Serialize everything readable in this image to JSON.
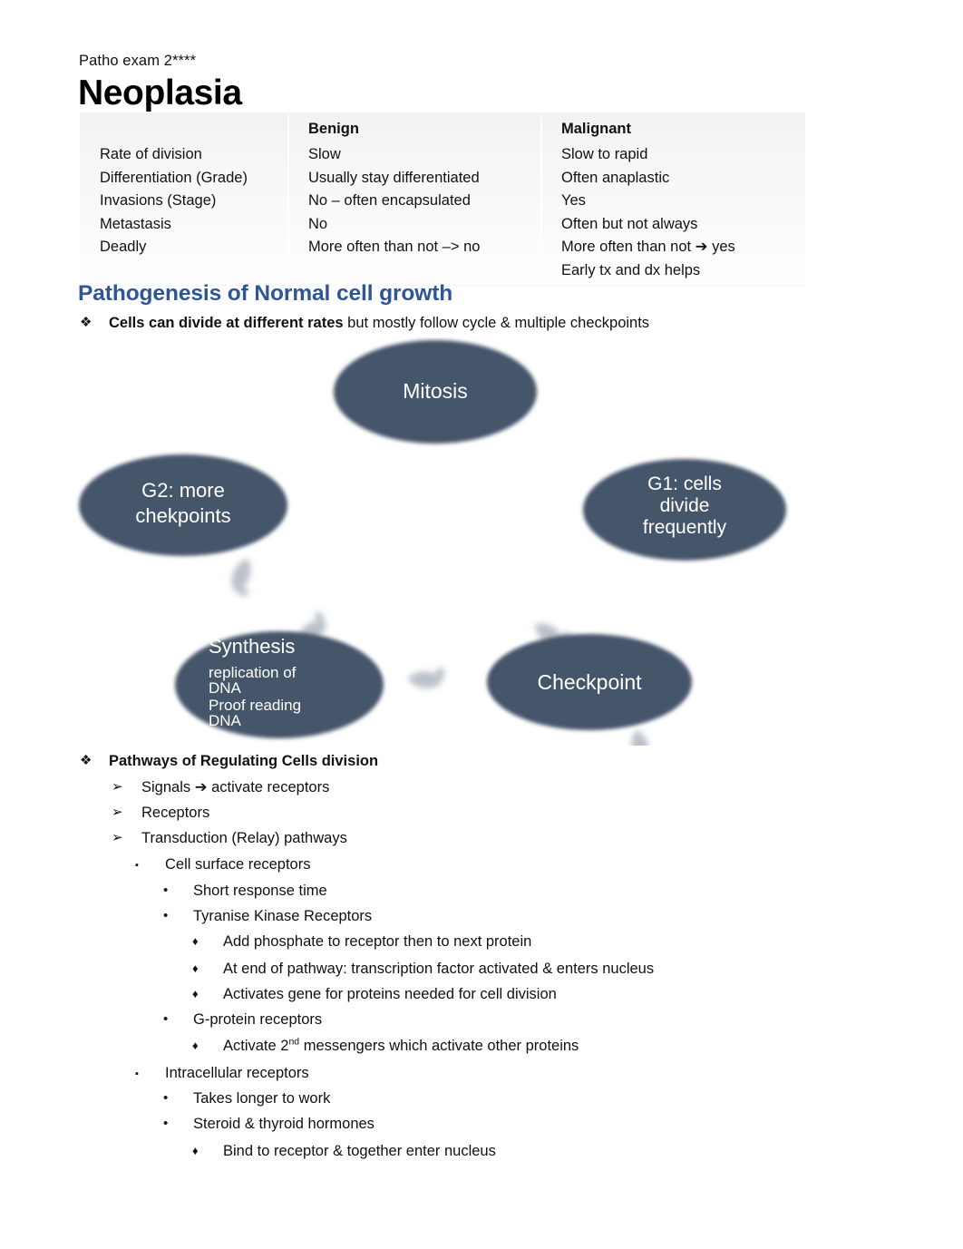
{
  "document": {
    "tagline": "Patho exam 2****",
    "title": "Neoplasia"
  },
  "comparison_table": {
    "headers": [
      "",
      "Benign",
      "Malignant"
    ],
    "rows": [
      {
        "label": "Rate of division",
        "benign": "Slow",
        "malignant": "Slow to rapid",
        "malignant_extra": ""
      },
      {
        "label": "Differentiation (Grade)",
        "benign": "Usually stay differentiated",
        "malignant": "Often anaplastic",
        "malignant_extra": ""
      },
      {
        "label": "Invasions (Stage)",
        "benign": "No – often encapsulated",
        "malignant": "Yes",
        "malignant_extra": ""
      },
      {
        "label": "Metastasis",
        "benign": "No",
        "malignant": "Often but not always",
        "malignant_extra": ""
      },
      {
        "label": "Deadly",
        "benign": "More often than not –> no",
        "malignant": "More often than not ➔ yes",
        "malignant_extra": "Early tx and dx helps"
      }
    ]
  },
  "section": {
    "heading": "Pathogenesis of Normal cell growth",
    "heading_color": "#2f5596"
  },
  "bullets": {
    "b1_bold": "Cells can divide at different rates",
    "b1_rest": " but mostly follow cycle & multiple checkpoints",
    "b2": "Pathways of Regulating Cells division",
    "b3": "Signals ➔ activate receptors",
    "b4": "Receptors",
    "b5": "Transduction (Relay) pathways",
    "b6": "Cell surface receptors",
    "b7": "Short response time",
    "b8": "Tyranise Kinase Receptors",
    "b9": "Add phosphate to receptor then to next protein",
    "b10": "At end of pathway: transcription factor activated & enters nucleus",
    "b11": "Activates gene for proteins needed for cell division",
    "b12": "G-protein receptors",
    "b13_pre": "Activate 2",
    "b13_sup": "nd",
    "b13_post": " messengers which activate other proteins",
    "b14": "Intracellular receptors",
    "b15": "Takes longer to work",
    "b16": "Steroid & thyroid hormones",
    "b17": "Bind to receptor & together enter nucleus"
  },
  "markers": {
    "level1": "❖",
    "level2": "➢",
    "level3": "▪",
    "level4": "•",
    "level5": "♦"
  },
  "cycle_diagram": {
    "fill_color": "#44546a",
    "connector_color": "#a6adb8",
    "nodes": [
      {
        "id": "mitosis",
        "title": "Mitosis",
        "lines": []
      },
      {
        "id": "g1",
        "title": "G1: cells",
        "lines": [
          "divide",
          "frequently"
        ]
      },
      {
        "id": "checkpoint",
        "title": "Checkpoint",
        "lines": []
      },
      {
        "id": "synthesis",
        "title": "Synthesis",
        "lines": [
          "replication of",
          "DNA",
          "Proof reading",
          "DNA"
        ]
      },
      {
        "id": "g2",
        "title": "G2: more",
        "lines": [
          "chekpoints"
        ]
      }
    ]
  }
}
